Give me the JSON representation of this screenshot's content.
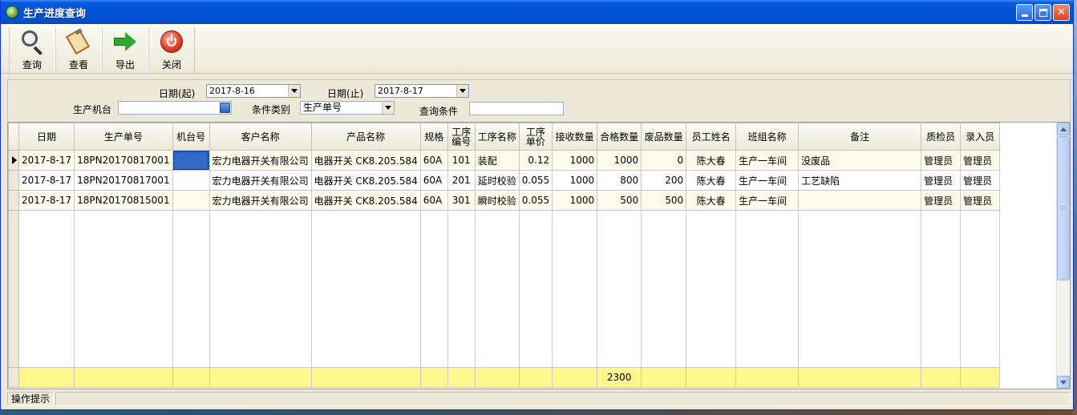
{
  "window": {
    "title": "生产进度查询"
  },
  "toolbar": {
    "query_label": "查询",
    "view_label": "查看",
    "export_label": "导出",
    "close_label": "关闭"
  },
  "filters": {
    "date_start_label": "日期(起)",
    "date_start_value": "2017-8-16",
    "date_end_label": "日期(止)",
    "date_end_value": "2017-8-17",
    "machine_label": "生产机台",
    "machine_value": "",
    "condition_type_label": "条件类别",
    "condition_type_value": "生产单号",
    "condition_label": "查询条件",
    "condition_value": ""
  },
  "grid": {
    "headers": {
      "date": "日期",
      "order_no": "生产单号",
      "machine_no": "机台号",
      "customer": "客户名称",
      "product": "产品名称",
      "spec": "规格",
      "process_no_1": "工序",
      "process_no_2": "编号",
      "process_name": "工序名称",
      "unit_price_1": "工序",
      "unit_price_2": "单价",
      "received_qty": "接收数量",
      "qualified_qty": "合格数量",
      "scrap_qty": "废品数量",
      "employee": "员工姓名",
      "team": "班组名称",
      "remark": "备注",
      "inspector": "质检员",
      "entered_by": "录入员"
    },
    "rows": [
      {
        "date": "2017-8-17",
        "order_no": "18PN20170817001",
        "machine_no": "",
        "customer": "宏力电器开关有限公司",
        "product": "电器开关 CK8.205.584",
        "spec": "60A",
        "process_no": "101",
        "process_name": "装配",
        "unit_price": "0.12",
        "received_qty": "1000",
        "qualified_qty": "1000",
        "scrap_qty": "0",
        "employee": "陈大春",
        "team": "生产一车间",
        "remark": "没废品",
        "inspector": "管理员",
        "entered_by": "管理员"
      },
      {
        "date": "2017-8-17",
        "order_no": "18PN20170817001",
        "machine_no": "",
        "customer": "宏力电器开关有限公司",
        "product": "电器开关 CK8.205.584",
        "spec": "60A",
        "process_no": "201",
        "process_name": "延时校验",
        "unit_price": "0.055",
        "received_qty": "1000",
        "qualified_qty": "800",
        "scrap_qty": "200",
        "employee": "陈大春",
        "team": "生产一车间",
        "remark": "工艺缺陷",
        "inspector": "管理员",
        "entered_by": "管理员"
      },
      {
        "date": "2017-8-17",
        "order_no": "18PN20170815001",
        "machine_no": "",
        "customer": "宏力电器开关有限公司",
        "product": "电器开关 CK8.205.584",
        "spec": "60A",
        "process_no": "301",
        "process_name": "瞬时校验",
        "unit_price": "0.055",
        "received_qty": "1000",
        "qualified_qty": "500",
        "scrap_qty": "500",
        "employee": "陈大春",
        "team": "生产一车间",
        "remark": "",
        "inspector": "管理员",
        "entered_by": "管理员"
      }
    ],
    "total_qualified_qty": "2300"
  },
  "statusbar": {
    "hint_label": "操作提示"
  },
  "colors": {
    "titlebar": "#0353d8",
    "row_alt": "#fdfbeb",
    "total_row": "#fff88e",
    "selected_cell": "#316ac5"
  }
}
